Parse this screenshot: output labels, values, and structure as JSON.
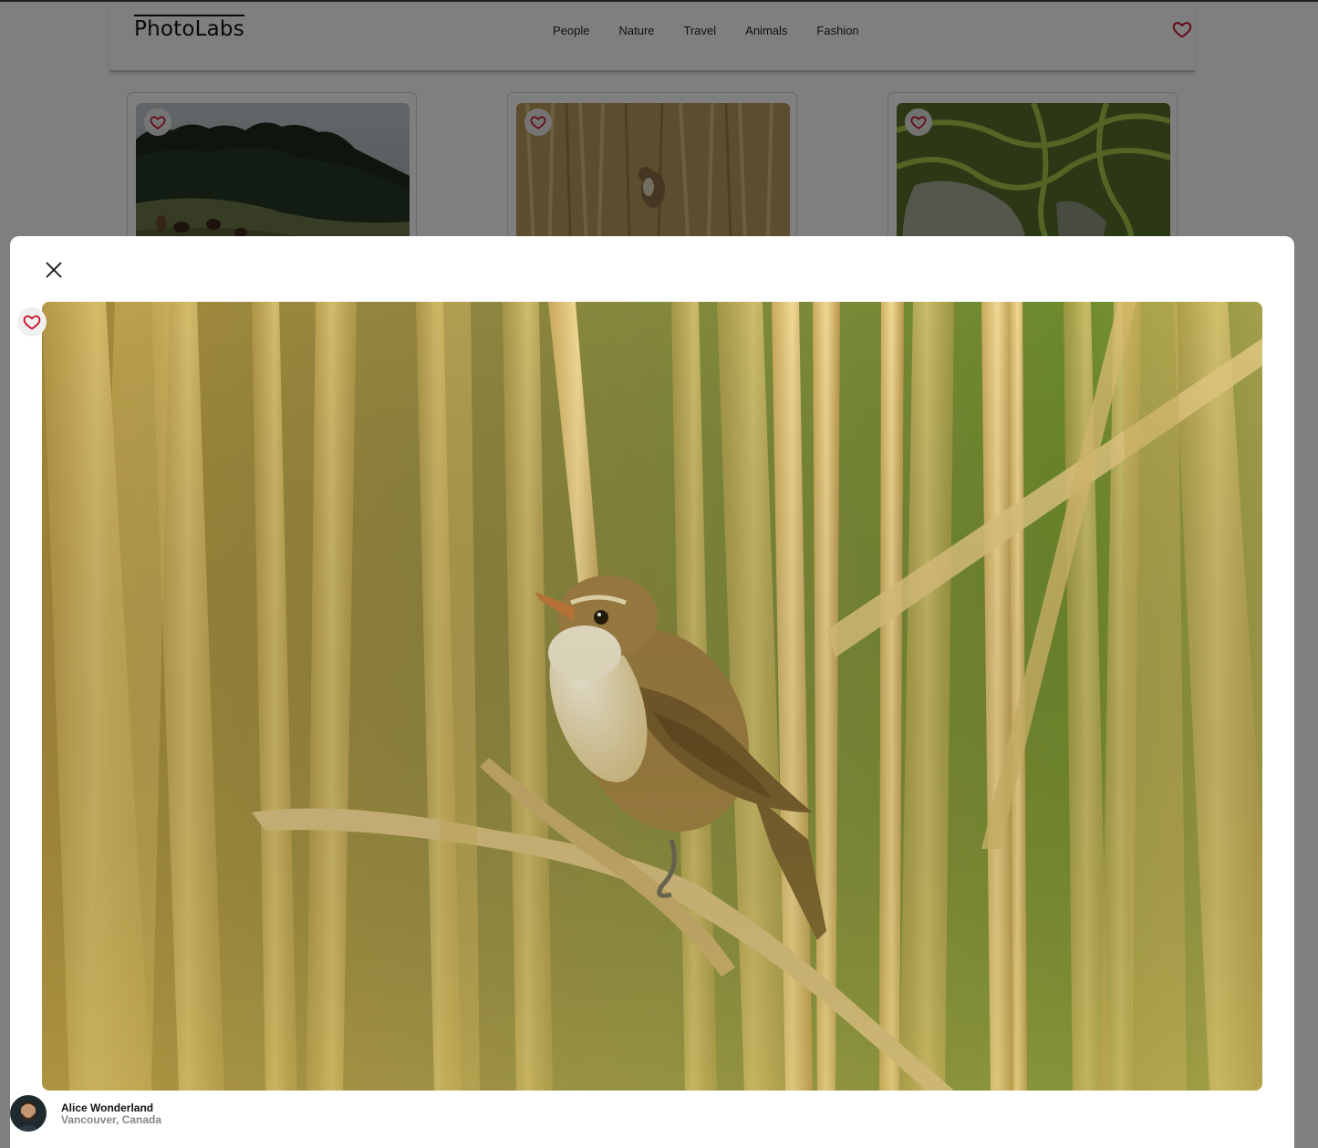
{
  "app": {
    "logo": "PhotoLabs",
    "topics": [
      "People",
      "Nature",
      "Travel",
      "Animals",
      "Fashion"
    ],
    "fav_icon": "heart-icon",
    "fav_color": "#c8102e"
  },
  "grid": {
    "cards": [
      {
        "subject": "hillside-forest-with-grazing-animals",
        "favorited": false
      },
      {
        "subject": "bird-in-reeds",
        "favorited": false
      },
      {
        "subject": "terraced-rice-fields",
        "favorited": false
      }
    ]
  },
  "modal": {
    "close_icon": "close-icon",
    "favorited": false,
    "photo_subject": "bird-perched-in-reeds",
    "photographer": {
      "name": "Alice Wonderland",
      "location": "Vancouver, Canada"
    }
  }
}
